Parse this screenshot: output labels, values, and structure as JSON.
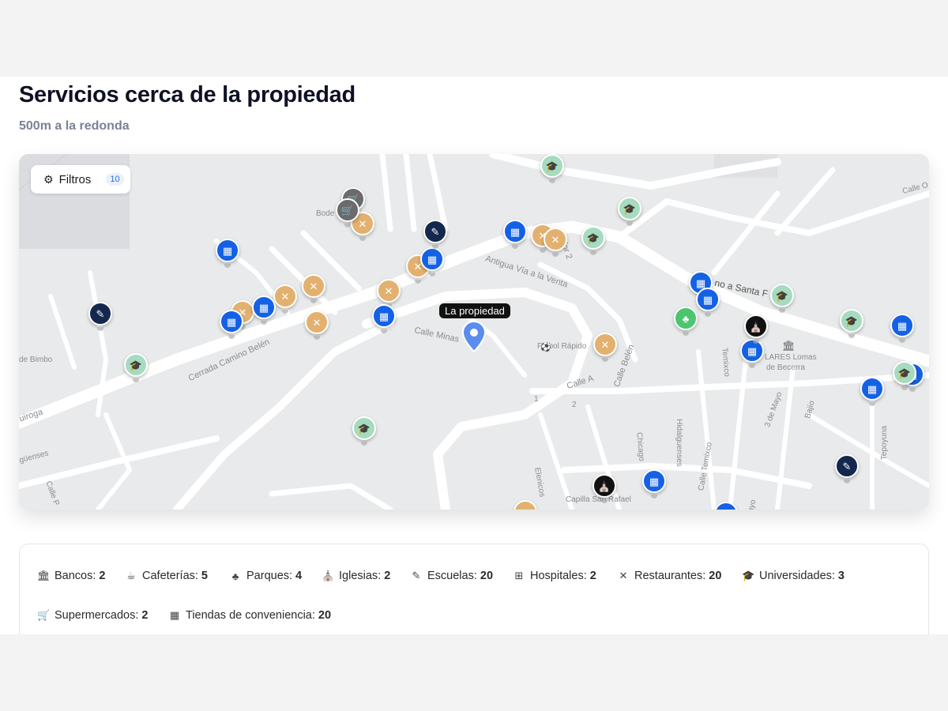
{
  "title": "Servicios cerca de la propiedad",
  "subtitle": "500m a la redonda",
  "filters": {
    "label": "Filtros",
    "count": "10"
  },
  "property_label": "La propiedad",
  "map_labels": {
    "bode": "Bode",
    "de_bimbo": "de Bimbo",
    "cerrada": "Cerrada Camino Belén",
    "antigua": "Antigua Vía a la Venta",
    "dor2": "dor 2",
    "calle_minas": "Calle Minas",
    "futbol": "Fútbol Rápido",
    "calle_a": "Calle A",
    "calle_belen": "Calle Belén",
    "santa": "no a Santa F",
    "lares1": "LARES Lomas",
    "lares2": "de Becerra",
    "temixco": "Temixco",
    "calle_temixco": "Calle Temixco",
    "hidalguenses": "Hidalguenses",
    "chicago": "Chicago",
    "elenicos": "Elenicos",
    "capilla": "Capilla San Rafael",
    "tres_mayo": "3 de Mayo",
    "bajio": "Bajío",
    "tepoyuna": "Tepoyuna",
    "quiroga": "uiroga",
    "guenses": "güenses",
    "calle_p": "Calle P",
    "calle_o": "Calle O",
    "one": "1",
    "two": "2",
    "mayo": "ayo"
  },
  "stats": [
    {
      "icon": "🏛",
      "icon_name": "bank-icon",
      "label": "Bancos:",
      "value": "2"
    },
    {
      "icon": "☕",
      "icon_name": "coffee-icon",
      "label": "Cafeterías:",
      "value": "5"
    },
    {
      "icon": "♣",
      "icon_name": "tree-icon",
      "label": "Parques:",
      "value": "4"
    },
    {
      "icon": "⛪",
      "icon_name": "church-icon",
      "label": "Iglesias:",
      "value": "2"
    },
    {
      "icon": "✎",
      "icon_name": "school-icon",
      "label": "Escuelas:",
      "value": "20"
    },
    {
      "icon": "⊞",
      "icon_name": "hospital-icon",
      "label": "Hospitales:",
      "value": "2"
    },
    {
      "icon": "✕",
      "icon_name": "restaurant-icon",
      "label": "Restaurantes:",
      "value": "20"
    },
    {
      "icon": "🎓",
      "icon_name": "graduation-cap-icon",
      "label": "Universidades:",
      "value": "3"
    },
    {
      "icon": "🛒",
      "icon_name": "cart-icon",
      "label": "Supermercados:",
      "value": "2"
    },
    {
      "icon": "▦",
      "icon_name": "store-icon",
      "label": "Tiendas de conveniencia:",
      "value": "20"
    }
  ],
  "pin_glyphs": {
    "store": "▦",
    "restaurant": "✕",
    "university": "🎓",
    "school": "✎",
    "park": "♣",
    "church": "⛪",
    "market": "🛒"
  },
  "colors": {
    "store": "#1461e5",
    "restaurant": "#e3b16f",
    "university": "#a7dbbf",
    "school": "#14284d",
    "park": "#4cc56f",
    "church": "#111111",
    "market": "#6b6b6b",
    "property": "#5b8dee"
  }
}
